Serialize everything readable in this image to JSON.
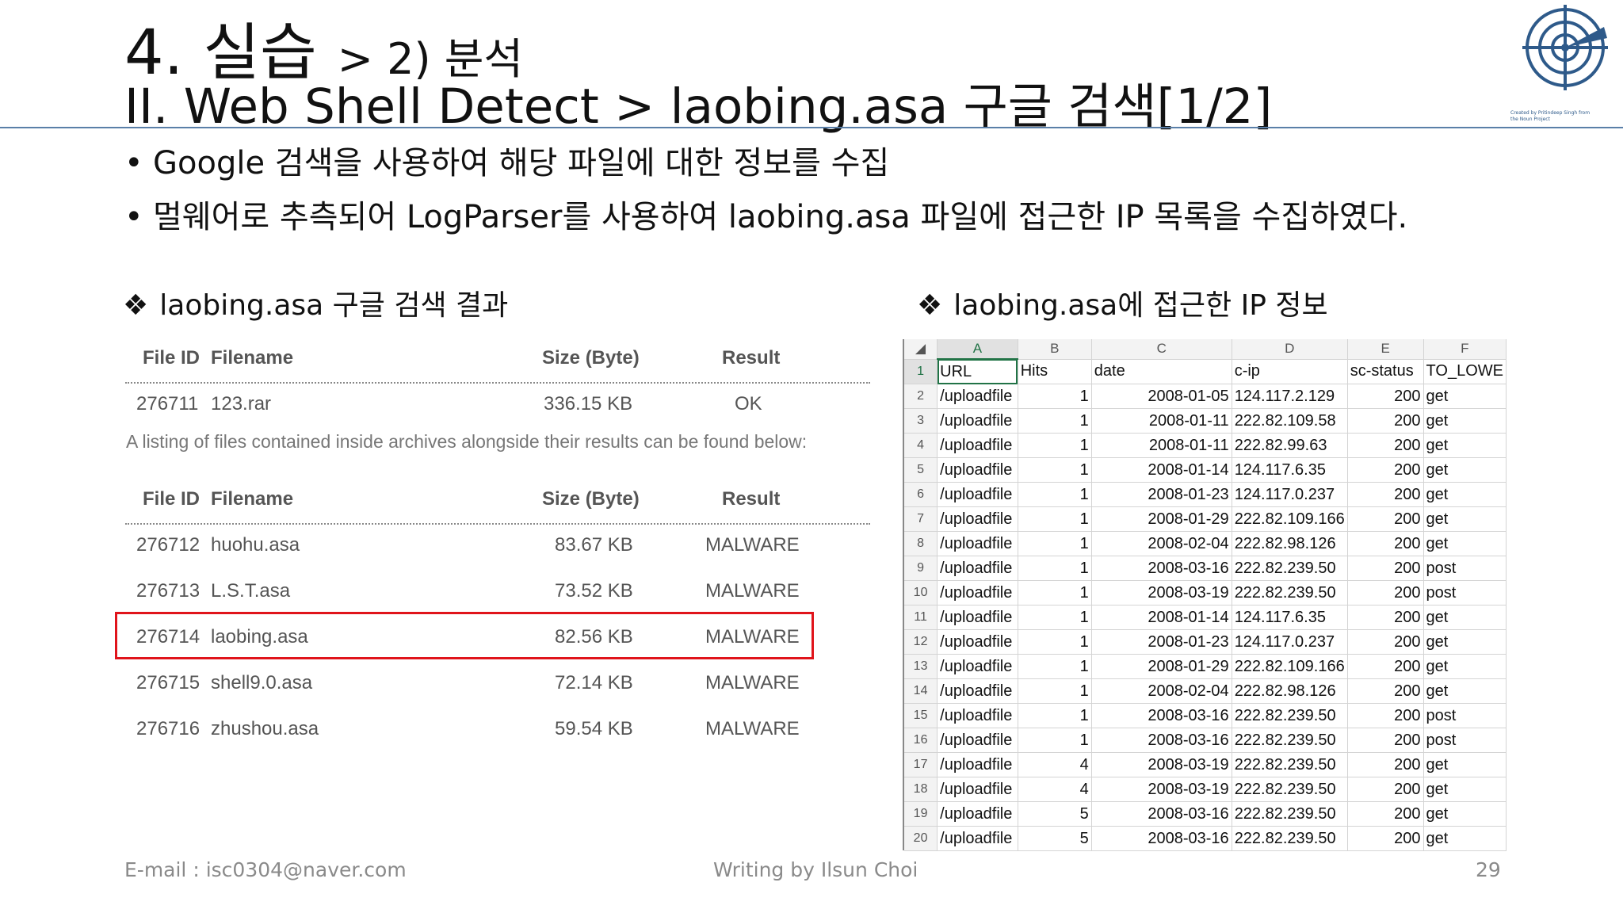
{
  "slide": {
    "title_prefix": "4. 실습",
    "title_suffix": "> 2) 분석",
    "subtitle": "II. Web Shell Detect > laobing.asa 구글 검색[1/2]",
    "logo_caption": "Created by Pritindeep Singh from the Noun Project",
    "bullets": [
      "Google 검색을 사용하여 해당 파일에 대한 정보를 수집",
      "멀웨어로 추측되어 LogParser를 사용하여 laobing.asa 파일에 접근한 IP 목록을 수집하였다."
    ],
    "bullet_symbol": "•",
    "section_marker": "❖",
    "left_heading": "laobing.asa 구글 검색 결과",
    "right_heading": "laobing.asa에 접근한 IP 정보",
    "footer": {
      "email": "E-mail : isc0304@naver.com",
      "author": "Writing by Ilsun Choi",
      "page": "29"
    }
  },
  "virustotal": {
    "headers": [
      "File ID",
      "Filename",
      "Size (Byte)",
      "Result"
    ],
    "archive": [
      {
        "id": "276711",
        "name": "123.rar",
        "size": "336.15 KB",
        "result": "OK"
      }
    ],
    "note": "A listing of files contained inside archives alongside their results can be found below:",
    "files": [
      {
        "id": "276712",
        "name": "huohu.asa",
        "size": "83.67 KB",
        "result": "MALWARE"
      },
      {
        "id": "276713",
        "name": "L.S.T.asa",
        "size": "73.52 KB",
        "result": "MALWARE"
      },
      {
        "id": "276714",
        "name": "laobing.asa",
        "size": "82.56 KB",
        "result": "MALWARE"
      },
      {
        "id": "276715",
        "name": "shell9.0.asa",
        "size": "72.14 KB",
        "result": "MALWARE"
      },
      {
        "id": "276716",
        "name": "zhushou.asa",
        "size": "59.54 KB",
        "result": "MALWARE"
      }
    ],
    "highlighted_file": "laobing.asa",
    "highlight_color": "#e0141b"
  },
  "spreadsheet": {
    "col_letters": [
      "A",
      "B",
      "C",
      "D",
      "E",
      "F"
    ],
    "header_row": [
      "URL",
      "Hits",
      "date",
      "c-ip",
      "sc-status",
      "TO_LOWE"
    ],
    "selected_cell": "A1",
    "accent_color": "#217346",
    "rows": [
      {
        "n": "2",
        "url": "/uploadfile",
        "hits": "1",
        "date": "2008-01-05",
        "ip": "124.117.2.129",
        "status": "200",
        "method": "get"
      },
      {
        "n": "3",
        "url": "/uploadfile",
        "hits": "1",
        "date": "2008-01-11",
        "ip": "222.82.109.58",
        "status": "200",
        "method": "get"
      },
      {
        "n": "4",
        "url": "/uploadfile",
        "hits": "1",
        "date": "2008-01-11",
        "ip": "222.82.99.63",
        "status": "200",
        "method": "get"
      },
      {
        "n": "5",
        "url": "/uploadfile",
        "hits": "1",
        "date": "2008-01-14",
        "ip": "124.117.6.35",
        "status": "200",
        "method": "get"
      },
      {
        "n": "6",
        "url": "/uploadfile",
        "hits": "1",
        "date": "2008-01-23",
        "ip": "124.117.0.237",
        "status": "200",
        "method": "get"
      },
      {
        "n": "7",
        "url": "/uploadfile",
        "hits": "1",
        "date": "2008-01-29",
        "ip": "222.82.109.166",
        "status": "200",
        "method": "get"
      },
      {
        "n": "8",
        "url": "/uploadfile",
        "hits": "1",
        "date": "2008-02-04",
        "ip": "222.82.98.126",
        "status": "200",
        "method": "get"
      },
      {
        "n": "9",
        "url": "/uploadfile",
        "hits": "1",
        "date": "2008-03-16",
        "ip": "222.82.239.50",
        "status": "200",
        "method": "post"
      },
      {
        "n": "10",
        "url": "/uploadfile",
        "hits": "1",
        "date": "2008-03-19",
        "ip": "222.82.239.50",
        "status": "200",
        "method": "post"
      },
      {
        "n": "11",
        "url": "/uploadfile",
        "hits": "1",
        "date": "2008-01-14",
        "ip": "124.117.6.35",
        "status": "200",
        "method": "get"
      },
      {
        "n": "12",
        "url": "/uploadfile",
        "hits": "1",
        "date": "2008-01-23",
        "ip": "124.117.0.237",
        "status": "200",
        "method": "get"
      },
      {
        "n": "13",
        "url": "/uploadfile",
        "hits": "1",
        "date": "2008-01-29",
        "ip": "222.82.109.166",
        "status": "200",
        "method": "get"
      },
      {
        "n": "14",
        "url": "/uploadfile",
        "hits": "1",
        "date": "2008-02-04",
        "ip": "222.82.98.126",
        "status": "200",
        "method": "get"
      },
      {
        "n": "15",
        "url": "/uploadfile",
        "hits": "1",
        "date": "2008-03-16",
        "ip": "222.82.239.50",
        "status": "200",
        "method": "post"
      },
      {
        "n": "16",
        "url": "/uploadfile",
        "hits": "1",
        "date": "2008-03-16",
        "ip": "222.82.239.50",
        "status": "200",
        "method": "post"
      },
      {
        "n": "17",
        "url": "/uploadfile",
        "hits": "4",
        "date": "2008-03-19",
        "ip": "222.82.239.50",
        "status": "200",
        "method": "get"
      },
      {
        "n": "18",
        "url": "/uploadfile",
        "hits": "4",
        "date": "2008-03-19",
        "ip": "222.82.239.50",
        "status": "200",
        "method": "get"
      },
      {
        "n": "19",
        "url": "/uploadfile",
        "hits": "5",
        "date": "2008-03-16",
        "ip": "222.82.239.50",
        "status": "200",
        "method": "get"
      },
      {
        "n": "20",
        "url": "/uploadfile",
        "hits": "5",
        "date": "2008-03-16",
        "ip": "222.82.239.50",
        "status": "200",
        "method": "get"
      }
    ]
  }
}
